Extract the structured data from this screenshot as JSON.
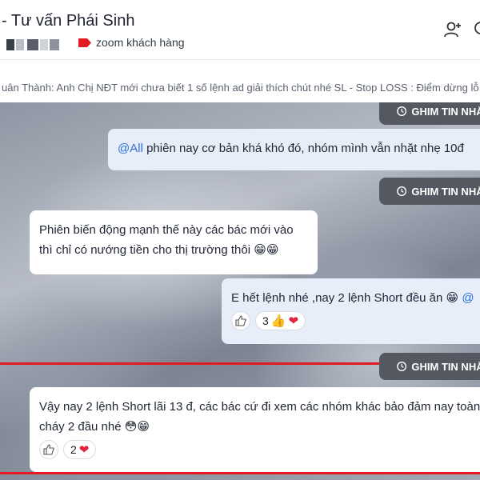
{
  "header": {
    "title": "- Tư vấn Phái Sinh",
    "tag_label": "zoom khách hàng",
    "tag_color": "#e11b22",
    "icons": [
      "add-member-icon",
      "search-icon"
    ]
  },
  "pinned_preview": {
    "text": "uân Thành: Anh Chị NĐT mới chưa biết 1 số lệnh ad giải thích chút nhé SL - Stop LOSS : Điểm dừng lỗ TP"
  },
  "chat": {
    "pin_label": "GHIM TIN NHẮN",
    "messages": [
      {
        "mention": "@All",
        "text": "phiên nay cơ bản khá khó đó, nhóm mình vẫn nhặt nhẹ 10đ"
      },
      {
        "text": "Phiên biến động mạnh thế này các bác mới vào thì chỉ có nướng tiền cho thị trường thôi",
        "emoji": "😁😁"
      },
      {
        "text": "E hết lệnh nhé ,nay 2 lệnh Short đều ăn",
        "emoji": "😁",
        "mention": "@",
        "reaction_count": "3",
        "reaction_emoji": "👍"
      },
      {
        "text": "Vậy nay 2 lệnh Short lãi 13 đ, các bác cứ đi xem các nhóm khác bảo đảm nay toàn cháy 2 đầu nhé",
        "emoji": "😳😁",
        "reaction_count": "2"
      }
    ]
  },
  "colors": {
    "accent": "#2b6fd6",
    "highlight_line": "#e11b22",
    "pin_bg": "#545861"
  }
}
